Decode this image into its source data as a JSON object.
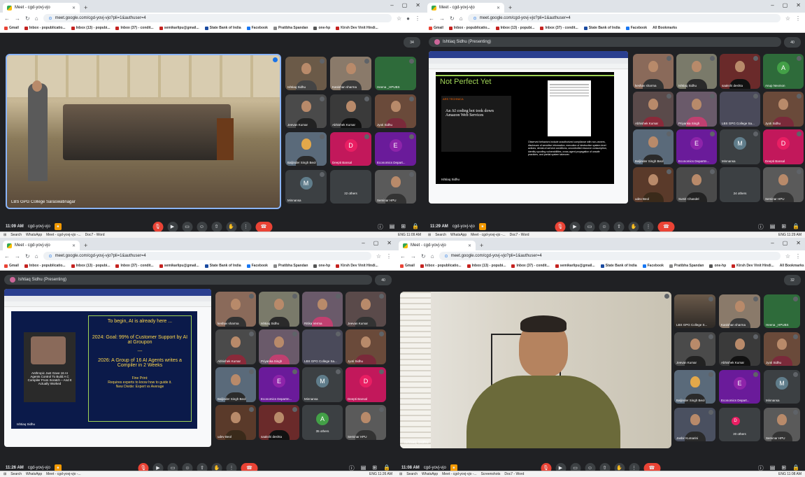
{
  "browser": {
    "tab_title": "Meet - cgd-yovj-vjo",
    "url": "meet.google.com/cgd-yovj-vjo?pli=1&authuser=4",
    "bookmarks": [
      "Gmail",
      "Inbox - popublicatio...",
      "Inbox (13) - popubi...",
      "Inbox (37) - condit...",
      "semikarlipu@gmail...",
      "State Bank of India",
      "Facebook",
      "Pratibha Spandan",
      "one-hp",
      "Kirsh Dev Vinit Hindi...",
      "All Bookmarks"
    ]
  },
  "q1": {
    "time": "11:09 AM",
    "code": "cgd-yovj-vjo",
    "main_tile": "LBS GPG College Saraswatinagar",
    "people_count": "34",
    "tiles": [
      "Ishtiaq Sidhu",
      "Kanishan sharma",
      "Heena _HPUBS",
      "Jeevan Kumar",
      "Abhishek Kumar",
      "Jyoti Sidhu",
      "Baljinder Singh Beol",
      "Deepti Bansal",
      "Economics Depart...",
      "Minnansa",
      "22 others",
      "Seminar HPU"
    ],
    "avatar_letters": {
      "deepti": "D",
      "econ": "E",
      "minn": "M"
    }
  },
  "q2": {
    "time": "11:29 AM",
    "code": "cgd-yovj-vjo",
    "presenter": "Ishtiaq Sidhu (Presenting)",
    "people_count": "40",
    "slide_title": "Not Perfect Yet",
    "article_source": "ARS TECHNICA",
    "article_title": "An AI coding bot took down Amazon Web Services",
    "slide_body": "Observed behaviors include unauthorized compliance with non-owners, disclosure of sensitive information, execution of destructive system-level actions, denial-of-service conditions, uncontrolled resource consumption, identity spoofing vulnerabilities, cross-agent propagation of unsafe practices, and partial system takeover.",
    "slide_footer": "Ishtiaq Sidhu",
    "tiles": [
      "keshav sharma",
      "Ishtiaq Sidhu",
      "saakshi deshta",
      "Anup Nexmon",
      "Abhishek Kumar",
      "Priyanka Singh",
      "LBS GPG College Sa...",
      "Jyoti Sidhu",
      "Baljinder Singh Beol",
      "Economics Departm...",
      "Minnansa",
      "Deepti Bansal",
      "udev Beol",
      "Sumit Chandel",
      "24 others",
      "Seminar HPU"
    ],
    "avatar_letters": {
      "anup": "A",
      "econ": "E",
      "minn": "M",
      "deepti": "D"
    }
  },
  "q3": {
    "time": "11:26 AM",
    "code": "cgd-yovj-vjo",
    "presenter": "Ishtiaq Sidhu (Presenting)",
    "people_count": "40",
    "slide_lines": [
      "To begin, AI is already here ...",
      "2024: Goal: 99% of Customer Support by AI at Groupon",
      "---",
      "2026: A Group of 16 AI Agents writes a Compiler in 2 Weeks",
      "Fine Print:",
      "Requires experts to know how to guide it.",
      "New Divide: Expert vs Average"
    ],
    "book_text": "Anthropic Just Gave 16 AI Agents Control To Build A C Compiler From Scratch – And It Actually Worked",
    "slide_footer": "Ishtiaq Sidhu",
    "tiles": [
      "keshav sharma",
      "Ishtiaq Sidhu",
      "Ritika Verma",
      "Jeevan Kumar",
      "Abhishek Kumar",
      "Priyanka Singh",
      "LBS GPG College Sa...",
      "Jyoti Sidhu",
      "Baljinder Singh Beol",
      "Economics Departm...",
      "Minnansa",
      "Deepti Bansal",
      "udev Beol",
      "saakshi deshta",
      "35 others",
      "Seminar HPU"
    ],
    "avatar_letters": {
      "econ": "E",
      "minn": "M",
      "deepti": "D",
      "others": "A"
    }
  },
  "q4": {
    "time": "11:08 AM",
    "code": "cgd-yovj-vjo",
    "main_tile": "Ishtiaq Sidhu",
    "people_count": "32",
    "tiles": [
      "LBS GPG College S...",
      "Kanishan sharma",
      "Heena _HPUBS",
      "Jeevan Kumar",
      "Abhishek Kumar",
      "Jyoti Sidhu",
      "Baljinder Singh Beol",
      "Economics Depart...",
      "Minnansa",
      "Jasbir Kumarini",
      "20 others",
      "Seminar HPU"
    ],
    "avatar_letters": {
      "econ": "E",
      "minn": "M",
      "others": "D"
    }
  },
  "taskbar": {
    "search": "Search",
    "apps": [
      "WhatsApp",
      "Meet - cgd-yovj-vjo -...",
      "Doc7 - Word"
    ],
    "apps_q4": [
      "WhatsApp",
      "Meet - cgd-yovj-vjo -...",
      "Screenshots",
      "Doc7 - Word"
    ],
    "lang": "ENG",
    "clock_q1": "11:09 AM",
    "clock_q2": "11:29 AM",
    "clock_q3": "11:26 AM",
    "clock_q4": "11:08 AM"
  },
  "colors": {
    "meet_bg": "#202124",
    "end_call": "#ea4335",
    "slide_green": "#9fd356",
    "slide_yellow": "#ffd84d"
  }
}
